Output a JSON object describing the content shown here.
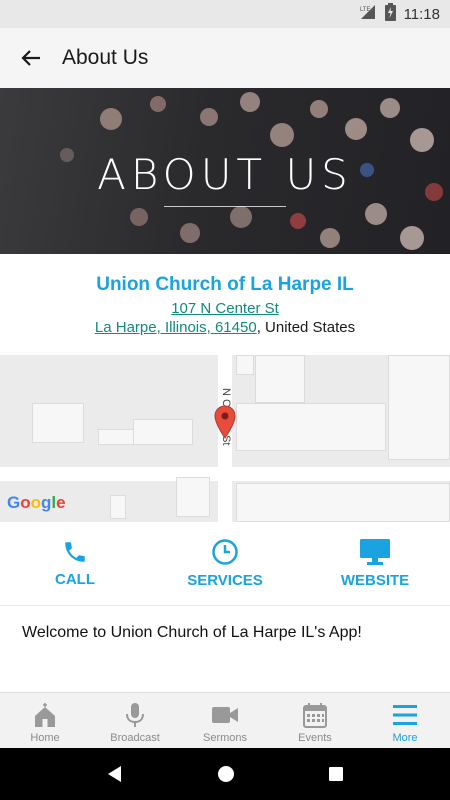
{
  "status_bar": {
    "time": "11:18",
    "network": "LTE"
  },
  "app_bar": {
    "title": "About Us"
  },
  "banner": {
    "title": "ABOUT US"
  },
  "church": {
    "name": "Union Church of La Harpe IL",
    "street": "107 N Center St",
    "city_line": "La Harpe, Illinois, 61450",
    "country": ", United States"
  },
  "map": {
    "street_label": "N Center St",
    "provider_logo": "Google"
  },
  "actions": [
    {
      "label": "CALL",
      "icon": "phone-icon"
    },
    {
      "label": "SERVICES",
      "icon": "clock-icon"
    },
    {
      "label": "WEBSITE",
      "icon": "monitor-icon"
    }
  ],
  "welcome_text": "Welcome to Union Church of La Harpe IL's App!",
  "bottom_nav": [
    {
      "label": "Home",
      "icon": "church-icon"
    },
    {
      "label": "Broadcast",
      "icon": "microphone-icon"
    },
    {
      "label": "Sermons",
      "icon": "video-camera-icon"
    },
    {
      "label": "Events",
      "icon": "calendar-icon"
    },
    {
      "label": "More",
      "icon": "menu-icon",
      "active": true
    }
  ],
  "colors": {
    "accent": "#1aa3e0",
    "link": "#118a7e",
    "nav_inactive": "#8a8a8a"
  }
}
